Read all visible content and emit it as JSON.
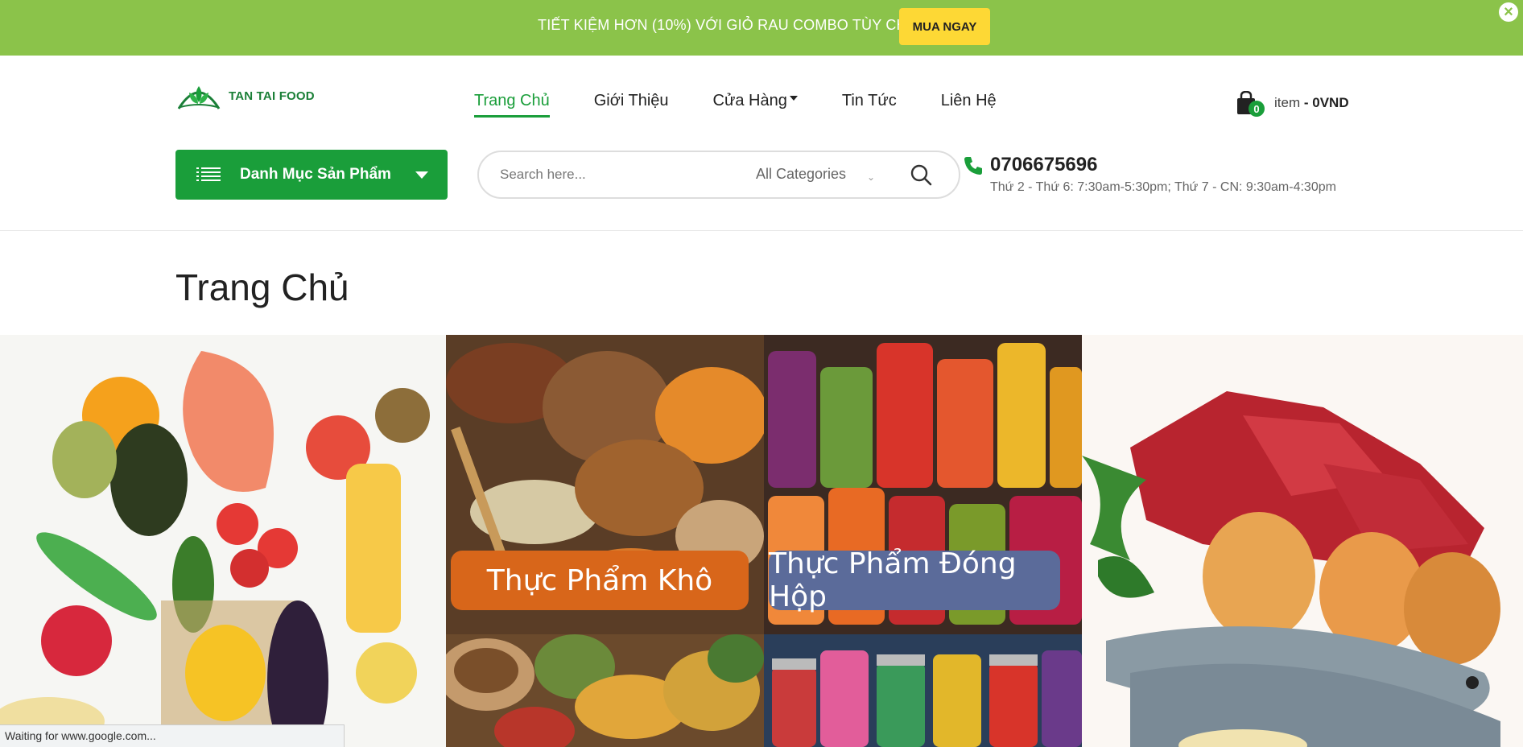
{
  "promo": {
    "text": "TIẾT KIỆM HƠN (10%) VỚI GIỎ RAU COMBO TÙY CHỌN",
    "button": "MUA NGAY",
    "close": "×",
    "bg_color": "#8bc34a",
    "button_color": "#fdd835"
  },
  "header": {
    "logo_text": "TAN TAI FOOD",
    "nav": [
      {
        "label": "Trang Chủ",
        "active": true
      },
      {
        "label": "Giới Thiệu"
      },
      {
        "label": "Cửa Hàng",
        "has_dropdown": true
      },
      {
        "label": "Tin Tức"
      },
      {
        "label": "Liên Hệ"
      }
    ],
    "cart": {
      "count": "0",
      "item_label": "item",
      "total": "- 0VND"
    },
    "category_button": "Danh Mục Sản Phẩm",
    "search": {
      "placeholder": "Search here...",
      "category": "All Categories"
    },
    "phone": "0706675696",
    "hours": "Thứ 2 - Thứ 6: 7:30am-5:30pm; Thứ 7 - CN: 9:30am-4:30pm",
    "accent_color": "#1a9e3a"
  },
  "main": {
    "title": "Trang Chủ",
    "banners": [
      {
        "label": ""
      },
      {
        "label": "Thực Phẩm Khô"
      },
      {
        "label": "Thực Phẩm Đóng Hộp"
      },
      {
        "label": ""
      },
      {
        "label": ""
      },
      {
        "label": ""
      }
    ]
  },
  "status_bar": {
    "text": "Waiting for www.google.com..."
  }
}
